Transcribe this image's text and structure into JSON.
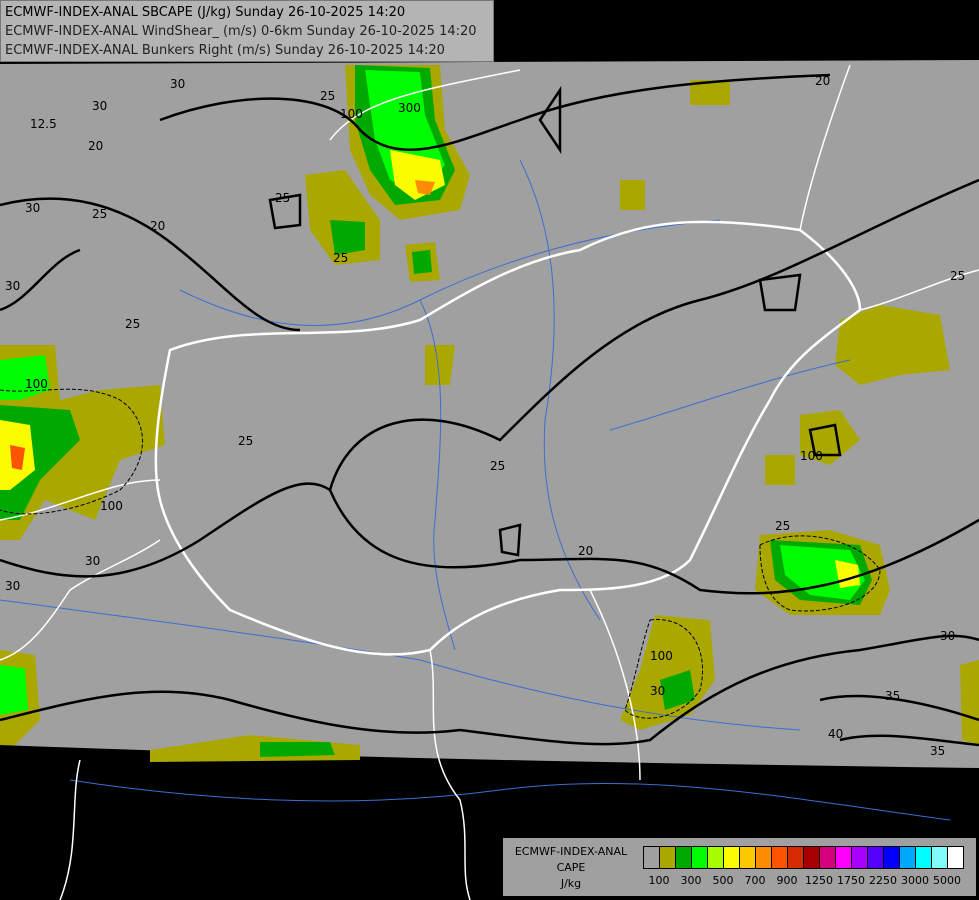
{
  "titles": [
    "ECMWF-INDEX-ANAL SBCAPE (J/kg) Sunday 26-10-2025 14:20",
    "ECMWF-INDEX-ANAL WindShear_ (m/s) 0-6km Sunday 26-10-2025 14:20",
    "ECMWF-INDEX-ANAL Bunkers Right (m/s) Sunday 26-10-2025 14:20"
  ],
  "legend": {
    "model": "ECMWF-INDEX-ANAL",
    "field": "CAPE",
    "unit": "J/kg",
    "colors": [
      "#a0a0a0",
      "#aaa800",
      "#00a800",
      "#00fc00",
      "#a8fc00",
      "#fcfc00",
      "#fcc800",
      "#fc8c00",
      "#fc5400",
      "#d42c00",
      "#a80000",
      "#d4007c",
      "#fc00fc",
      "#a800fc",
      "#5400fc",
      "#0000fc",
      "#00a8fc",
      "#00fcfc",
      "#80fcfc",
      "#ffffff"
    ],
    "tick_labels": [
      "100",
      "300",
      "500",
      "700",
      "900",
      "1250",
      "1750",
      "2250",
      "3000",
      "5000"
    ]
  },
  "map": {
    "no_data_color": "#000000",
    "data_area_color": "#a0a0a0",
    "border_color": "#ffffff",
    "river_color": "#3c6ed2",
    "contour_color": "#000000",
    "contour_labels": [
      "12.5",
      "20",
      "30",
      "25",
      "30",
      "25",
      "30",
      "25",
      "100",
      "300",
      "25",
      "25",
      "100",
      "30",
      "25",
      "20",
      "25",
      "20",
      "30",
      "30",
      "100",
      "25",
      "100",
      "30",
      "35",
      "40",
      "35",
      "30",
      "25",
      "100",
      "20"
    ]
  }
}
